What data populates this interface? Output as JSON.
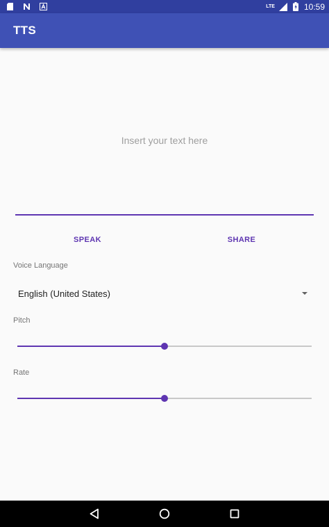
{
  "status_bar": {
    "time": "10:59",
    "network": "LTE",
    "icons": [
      "sim-card-icon",
      "n-notification-icon",
      "a-notification-icon",
      "signal-icon",
      "battery-icon"
    ]
  },
  "app_bar": {
    "title": "TTS"
  },
  "text_input": {
    "placeholder": "Insert your text here",
    "value": ""
  },
  "buttons": {
    "speak": "SPEAK",
    "share": "SHARE"
  },
  "voice_language": {
    "label": "Voice Language",
    "selected": "English (United States)"
  },
  "pitch": {
    "label": "Pitch",
    "value_fraction": 0.5
  },
  "rate": {
    "label": "Rate",
    "value_fraction": 0.5
  },
  "colors": {
    "status_bar": "#303f9f",
    "app_bar": "#3f51b5",
    "accent": "#5e35b1"
  },
  "nav_bar": {
    "icons": [
      "back-icon",
      "home-icon",
      "recent-apps-icon"
    ]
  }
}
